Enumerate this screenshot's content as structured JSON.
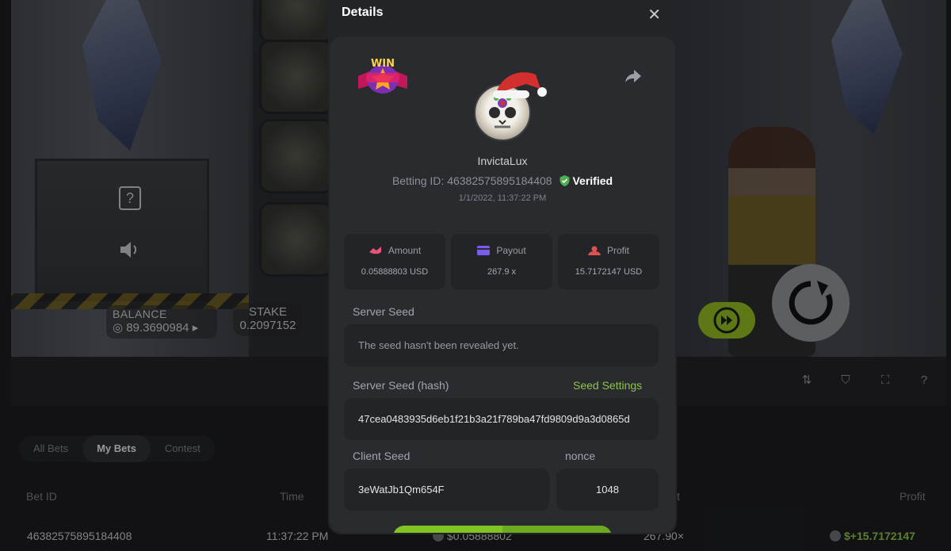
{
  "game": {
    "balance_label": "BALANCE",
    "balance_value": "89.3690984",
    "stake_label": "STAKE",
    "stake_value": "0.2097152",
    "question_mark": "?"
  },
  "bets_panel": {
    "tabs": [
      {
        "label": "All Bets",
        "active": false
      },
      {
        "label": "My Bets",
        "active": true
      },
      {
        "label": "Contest",
        "active": false
      }
    ],
    "columns": {
      "bet_id": "Bet ID",
      "time": "Time",
      "multiplier_partial": "t",
      "profit": "Profit"
    },
    "row": {
      "bet_id": "46382575895184408",
      "time": "11:37:22 PM",
      "amount": "$0.05888802",
      "multiplier": "267.90×",
      "profit": "$+15.7172147"
    },
    "toolbar_icons": [
      "stats-icon",
      "fairness-icon",
      "fullscreen-icon",
      "help-icon"
    ]
  },
  "modal": {
    "title": "Details",
    "close_symbol": "✕",
    "badge_text": "WIN",
    "username": "InvictaLux",
    "betting_id_label": "Betting ID:",
    "betting_id": "46382575895184408",
    "verified_label": "Verified",
    "timestamp": "1/1/2022, 11:37:22 PM",
    "stats": [
      {
        "label": "Amount",
        "value": "0.05888803 USD",
        "icon": "amount-icon",
        "color": "#e8537a"
      },
      {
        "label": "Payout",
        "value": "267.9 x",
        "icon": "payout-icon",
        "color": "#7a5cf0"
      },
      {
        "label": "Profit",
        "value": "15.7172147 USD",
        "icon": "profit-icon",
        "color": "#e0514f"
      }
    ],
    "server_seed_label": "Server Seed",
    "server_seed_value": "The seed hasn't been revealed yet.",
    "server_seed_hash_label": "Server Seed (hash)",
    "seed_settings_label": "Seed Settings",
    "server_seed_hash_value": "47cea0483935d6eb1f21b3a21f789ba47fd9809d9a3d0865d",
    "client_seed_label": "Client Seed",
    "client_seed_value": "3eWatJb1Qm654F",
    "nonce_label": "nonce",
    "nonce_value": "1048"
  },
  "colors": {
    "accent_green": "#8bc34a",
    "modal_bg": "#232427",
    "card_bg": "#2a2b2f",
    "verified_green": "#4caf50"
  }
}
